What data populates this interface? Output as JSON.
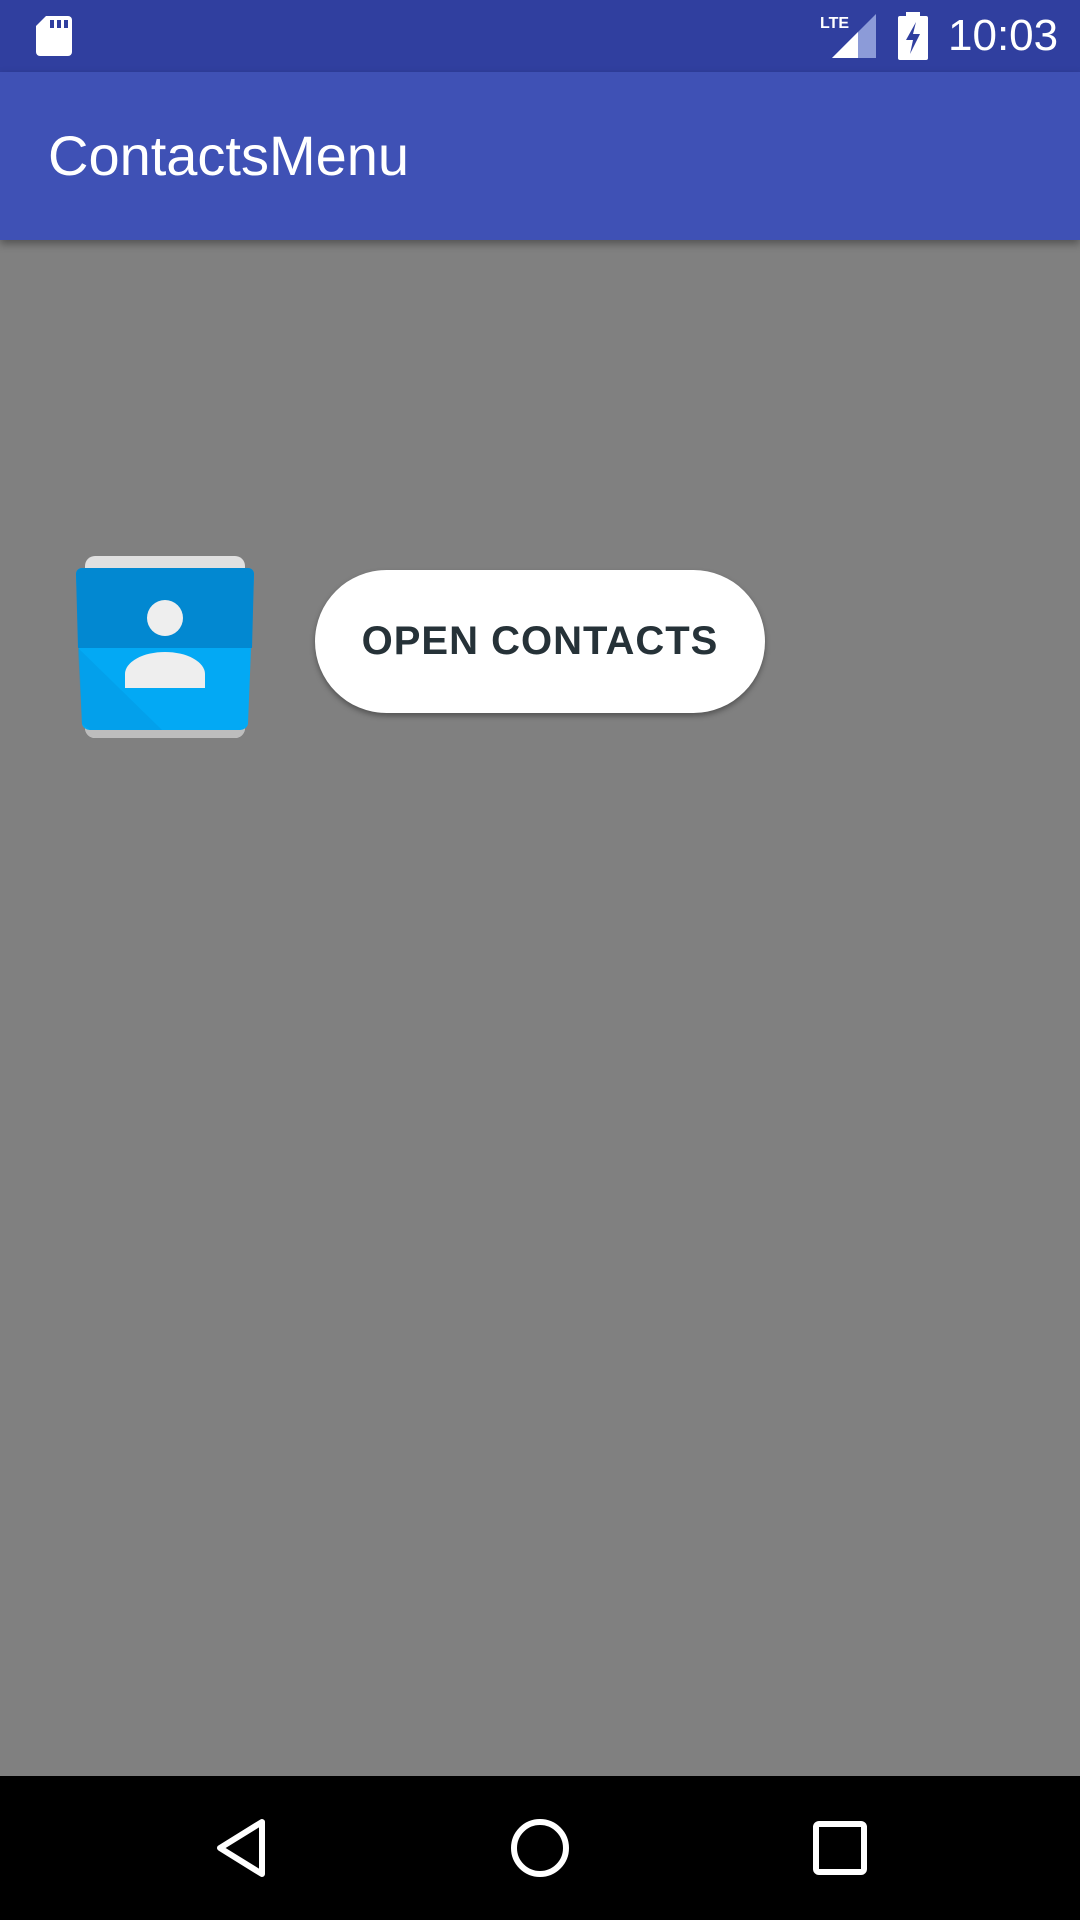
{
  "status_bar": {
    "network_label": "LTE",
    "time": "10:03",
    "icons": [
      "sd-card-icon",
      "lte-signal-icon",
      "battery-charging-icon"
    ]
  },
  "app_bar": {
    "title": "ContactsMenu"
  },
  "content": {
    "app_icon": "contacts-app-icon",
    "button_label": "OPEN CONTACTS"
  },
  "nav_bar": {
    "icons": [
      "back-icon",
      "home-icon",
      "recents-icon"
    ]
  },
  "colors": {
    "status_bar": "#303f9f",
    "app_bar": "#3f51b5",
    "background": "#808080",
    "button_bg": "#ffffff",
    "button_text": "#263238",
    "icon_blue_dark": "#0288d1",
    "icon_blue_light": "#03a9f4"
  }
}
